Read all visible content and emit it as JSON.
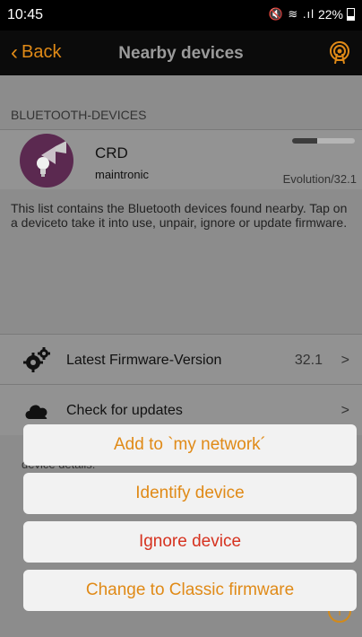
{
  "status_bar": {
    "time": "10:45",
    "signal_glyphs": "🔇 ≋ .ıl",
    "battery": "22%"
  },
  "nav": {
    "back_label": "Back",
    "title": "Nearby devices",
    "right_icon": "broadcast-icon"
  },
  "section": {
    "header": "BLUETOOTH-DEVICES"
  },
  "device": {
    "name": "CRD",
    "vendor": "maintronic",
    "version": "Evolution/32.1",
    "signal_level": 0.4,
    "icon": "lamp-icon"
  },
  "info_text": "This list contains the Bluetooth devices found nearby. Tap on a deviceto take it into use, unpair, ignore or update firmware.",
  "rows": [
    {
      "label": "Latest Firmware-Version",
      "value": "32.1",
      "icon": "gears-icon"
    },
    {
      "label": "Check for updates",
      "value": "",
      "icon": "cloud-icon"
    }
  ],
  "peek_text": "device details:",
  "help_label": "i",
  "actions": [
    {
      "label": "Add to `my network´",
      "style": "normal"
    },
    {
      "label": "Identify device",
      "style": "normal"
    },
    {
      "label": "Ignore device",
      "style": "danger"
    },
    {
      "label": "Change to Classic firmware",
      "style": "normal"
    }
  ],
  "colors": {
    "accent": "#e08a17",
    "danger": "#d6321f",
    "nav_bg": "#0b0b0b",
    "device_icon_bg": "#5b2950"
  }
}
